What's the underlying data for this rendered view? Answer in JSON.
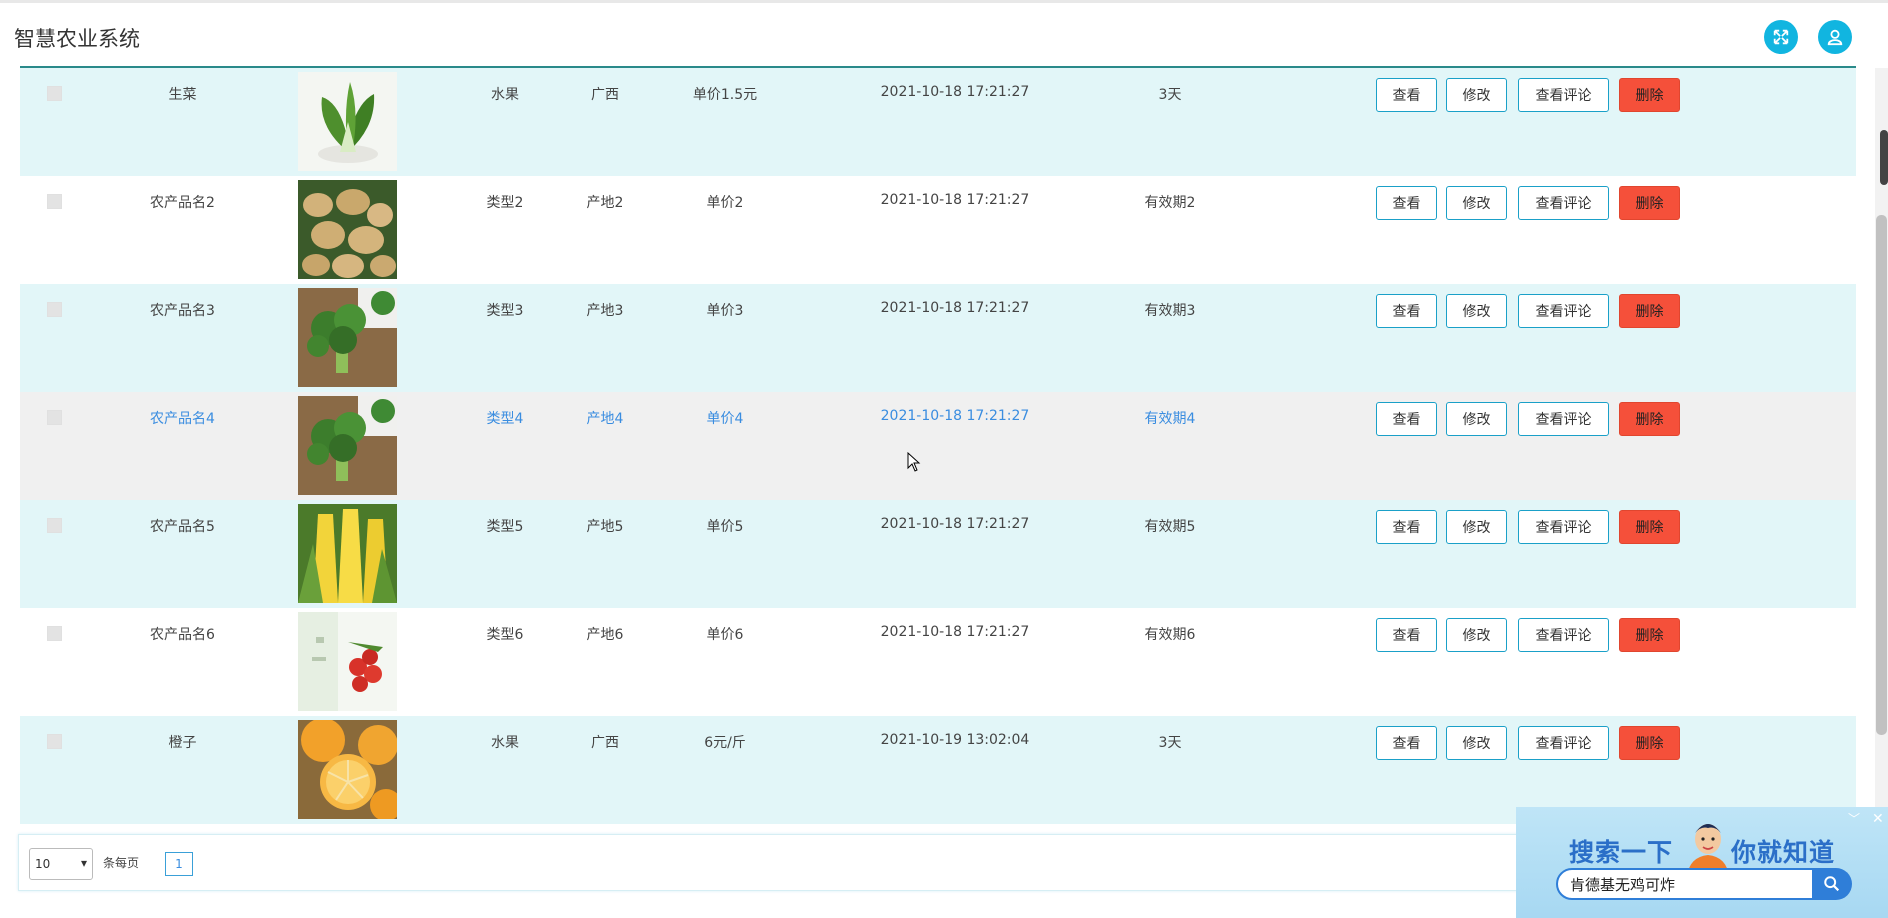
{
  "app": {
    "title": "智慧农业系统"
  },
  "columns_hidden": true,
  "rows": [
    {
      "name": "生菜",
      "type": "水果",
      "origin": "广西",
      "price": "单价1.5元",
      "time": "2021-10-18 17:21:27",
      "expiry": "3天",
      "image": "lettuce",
      "style": "alt"
    },
    {
      "name": "农产品名2",
      "type": "类型2",
      "origin": "产地2",
      "price": "单价2",
      "time": "2021-10-18 17:21:27",
      "expiry": "有效期2",
      "image": "potato",
      "style": "plain"
    },
    {
      "name": "农产品名3",
      "type": "类型3",
      "origin": "产地3",
      "price": "单价3",
      "time": "2021-10-18 17:21:27",
      "expiry": "有效期3",
      "image": "broccoli",
      "style": "alt"
    },
    {
      "name": "农产品名4",
      "type": "类型4",
      "origin": "产地4",
      "price": "单价4",
      "time": "2021-10-18 17:21:27",
      "expiry": "有效期4",
      "image": "broccoli",
      "style": "hover"
    },
    {
      "name": "农产品名5",
      "type": "类型5",
      "origin": "产地5",
      "price": "单价5",
      "time": "2021-10-18 17:21:27",
      "expiry": "有效期5",
      "image": "corn",
      "style": "alt"
    },
    {
      "name": "农产品名6",
      "type": "类型6",
      "origin": "产地6",
      "price": "单价6",
      "time": "2021-10-18 17:21:27",
      "expiry": "有效期6",
      "image": "tomato",
      "style": "plain"
    },
    {
      "name": "橙子",
      "type": "水果",
      "origin": "广西",
      "price": "6元/斤",
      "time": "2021-10-19 13:02:04",
      "expiry": "3天",
      "image": "orange",
      "style": "alt"
    }
  ],
  "actions": {
    "view": "查看",
    "edit": "修改",
    "comment": "查看评论",
    "delete": "删除"
  },
  "pager": {
    "page_size": "10",
    "per_page_label": "条每页",
    "current_page": "1"
  },
  "ad": {
    "title_left": "搜索一下",
    "title_right": "你就知道",
    "query": "肯德基无鸡可炸"
  },
  "colors": {
    "accent": "#11b5e0",
    "delete": "#f5503a",
    "row_alt": "#e2f6f8",
    "link": "#3a8de0"
  },
  "icons": {
    "fullscreen": "fullscreen-icon",
    "user": "user-icon",
    "search": "search-icon",
    "close": "close-icon"
  }
}
